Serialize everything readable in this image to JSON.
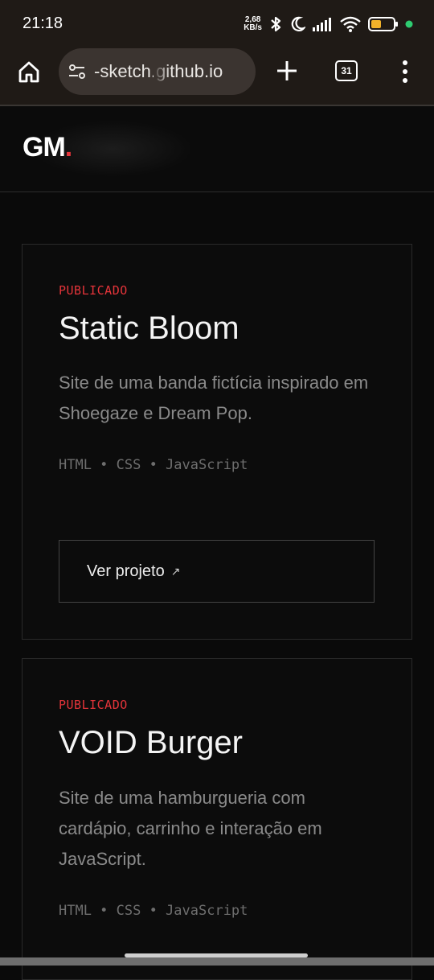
{
  "status_bar": {
    "time": "21:18",
    "net_speed_value": "2,68",
    "net_speed_unit": "KB/s",
    "icons": [
      "bluetooth-icon",
      "moon-icon",
      "signal-icon",
      "wifi-icon",
      "battery-icon"
    ],
    "battery_level": 0.45,
    "accent_dot_color": "#2ecc71"
  },
  "browser": {
    "url": "-sketch.github.io",
    "tab_count": "31",
    "icons": [
      "home-icon",
      "site-info-icon",
      "plus-icon",
      "tabs-icon",
      "more-vert-icon"
    ]
  },
  "site": {
    "logo_text": "GM",
    "logo_dot": "."
  },
  "projects": [
    {
      "status": "PUBLICADO",
      "title": "Static Bloom",
      "description": "Site de uma banda fictícia inspirado em Shoegaze e Dream Pop.",
      "tech": "HTML • CSS • JavaScript",
      "button_label": "Ver projeto",
      "button_icon": "↗"
    },
    {
      "status": "PUBLICADO",
      "title": "VOID Burger",
      "description": "Site de uma hamburgueria com cardápio, carrinho e interação em JavaScript.",
      "tech": "HTML • CSS • JavaScript"
    }
  ],
  "colors": {
    "accent": "#e5343a",
    "background": "#0a0a0a",
    "browser_chrome": "#1f1a16"
  }
}
